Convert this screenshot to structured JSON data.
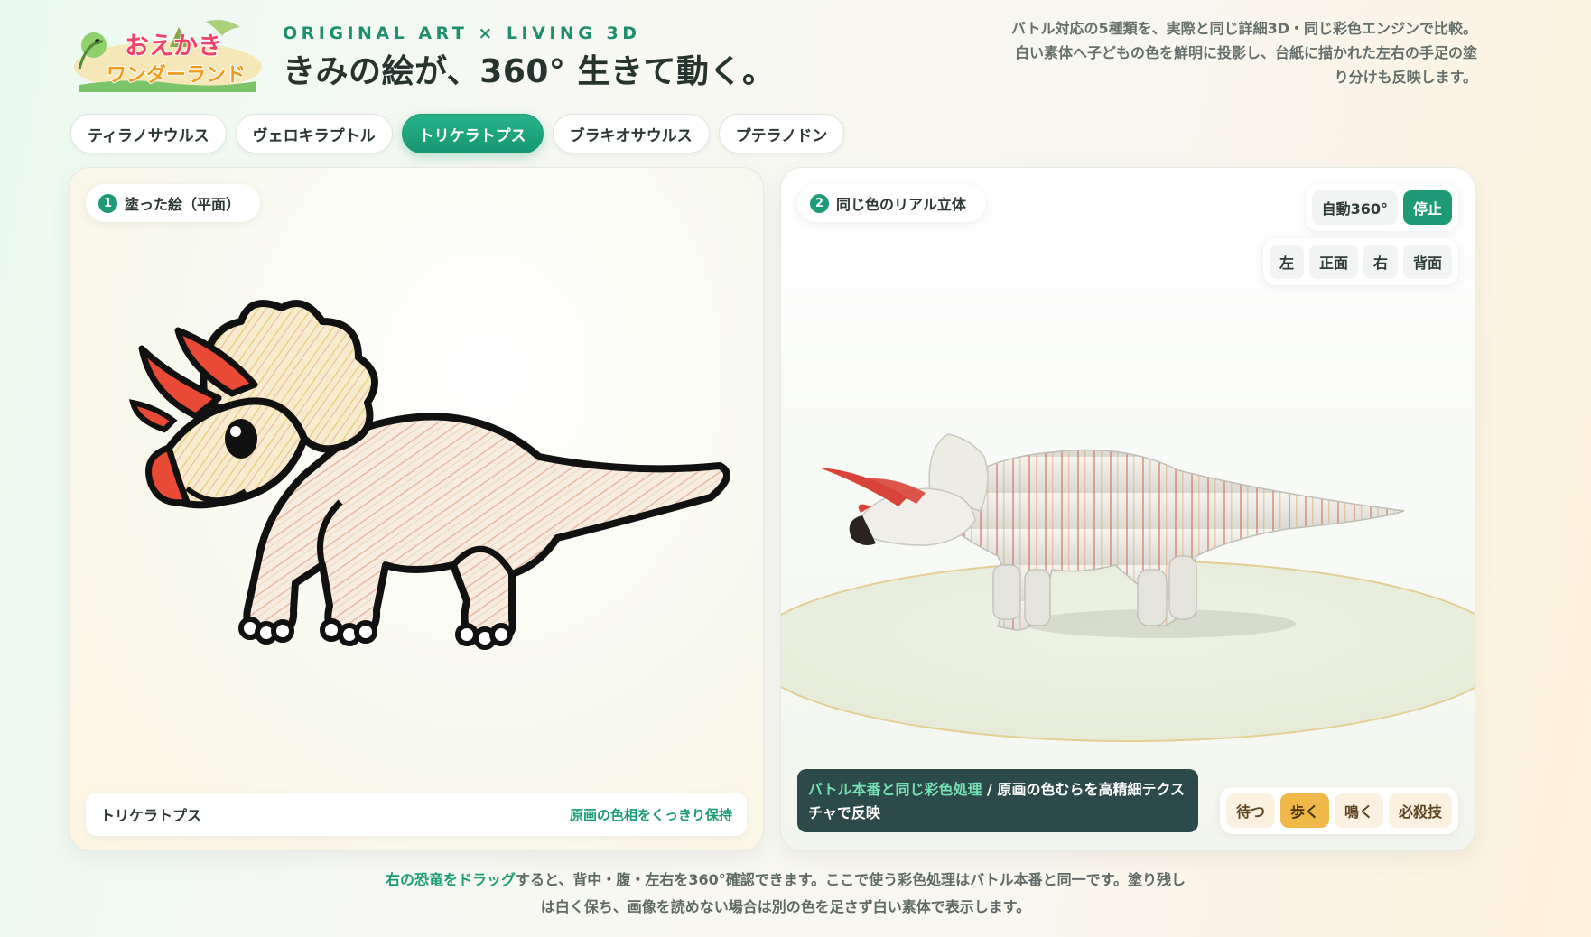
{
  "header": {
    "logo_text_top": "おえかき",
    "logo_text_bottom": "ワンダーランド",
    "eyebrow": "ORIGINAL ART × LIVING 3D",
    "headline": "きみの絵が、360° 生きて動く。",
    "intro": "バトル対応の5種類を、実際と同じ詳細3D・同じ彩色エンジンで比較。白い素体へ子どもの色を鮮明に投影し、台紙に描かれた左右の手足の塗り分けも反映します。"
  },
  "tabs": [
    {
      "label": "ティラノサウルス",
      "active": false
    },
    {
      "label": "ヴェロキラプトル",
      "active": false
    },
    {
      "label": "トリケラトプス",
      "active": true
    },
    {
      "label": "ブラキオサウルス",
      "active": false
    },
    {
      "label": "プテラノドン",
      "active": false
    }
  ],
  "left_panel": {
    "step": "1",
    "title": "塗った絵（平面）",
    "caption_name": "トリケラトプス",
    "caption_note": "原画の色相をくっきり保持"
  },
  "right_panel": {
    "step": "2",
    "title": "同じ色のリアル立体",
    "rotate_label": "自動360°",
    "stop_label": "停止",
    "views": [
      "左",
      "正面",
      "右",
      "背面"
    ],
    "badge_highlight": "バトル本番と同じ彩色処理",
    "badge_text": " / 原画の色むらを高精細テクスチャで反映",
    "animations": [
      {
        "label": "待つ",
        "active": false
      },
      {
        "label": "歩く",
        "active": true
      },
      {
        "label": "鳴く",
        "active": false
      },
      {
        "label": "必殺技",
        "active": false
      }
    ]
  },
  "footer": {
    "highlight": "右の恐竜をドラッグ",
    "text": "すると、背中・腹・左右を360°確認できます。ここで使う彩色処理はバトル本番と同一です。塗り残しは白く保ち、画像を読めない場合は別の色を足さず白い素体で表示します。"
  },
  "colors": {
    "accent": "#1d9b77",
    "badge_bg": "#2c4a49",
    "walk_active": "#f0b848"
  }
}
